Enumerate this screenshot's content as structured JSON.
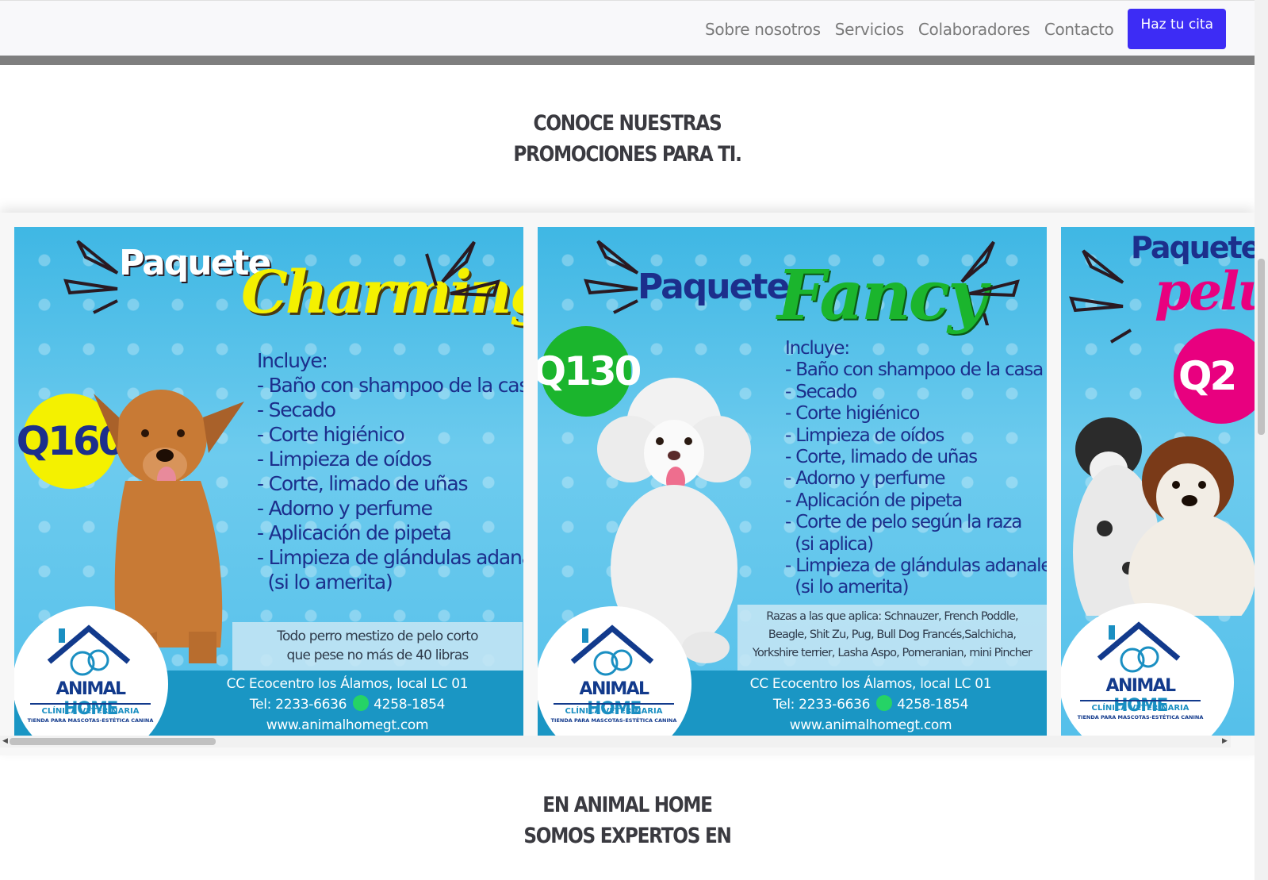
{
  "nav": {
    "links": [
      "Sobre nosotros",
      "Servicios",
      "Colaboradores",
      "Contacto"
    ],
    "cta": "Haz tu cita"
  },
  "promo_heading": {
    "line1": "CONOCE NUESTRAS",
    "line2": "PROMOCIONES PARA TI."
  },
  "cards": [
    {
      "paquete": "Paquete",
      "name": "Charming",
      "price": "Q160",
      "includes_label": "Incluye:",
      "items": [
        "- Baño con shampoo de la casa",
        "- Secado",
        "- Corte higiénico",
        "- Limpieza de oídos",
        "- Corte, limado de uñas",
        "- Adorno y perfume",
        "- Aplicación de pipeta",
        "- Limpieza de glándulas adanales",
        "  (si lo amerita)"
      ],
      "note": [
        "Todo perro mestizo de pelo corto",
        "que pese no más de 40 libras"
      ],
      "address": "CC Ecocentro los Álamos, local LC 01",
      "tel": "Tel: 2233-6636",
      "whatsapp": "4258-1854",
      "web": "www.animalhomegt.com",
      "logo": {
        "title_a": "ANIMAL",
        "title_b": "HOME",
        "sub1": "CLÍNICA VETERINARIA",
        "sub2": "TIENDA PARA MASCOTAS-ESTÉTICA CANINA"
      }
    },
    {
      "paquete": "Paquete",
      "name": "Fancy",
      "price": "Q130",
      "includes_label": "Incluye:",
      "items": [
        "- Baño con shampoo de la casa",
        "- Secado",
        "- Corte higiénico",
        "- Limpieza de oídos",
        "- Corte, limado de uñas",
        "- Adorno y perfume",
        "- Aplicación de pipeta",
        "- Corte de pelo según la raza",
        "  (si aplica)",
        "- Limpieza de glándulas adanales",
        "  (si lo amerita)"
      ],
      "note": [
        "Razas a las que aplica: Schnauzer, French Poddle,",
        "Beagle, Shit Zu, Pug, Bull Dog Francés,Salchicha,",
        "Yorkshire terrier, Lasha Aspo, Pomeranian, mini Pincher"
      ],
      "address": "CC Ecocentro los Álamos, local LC 01",
      "tel": "Tel: 2233-6636",
      "whatsapp": "4258-1854",
      "web": "www.animalhomegt.com",
      "logo": {
        "title_a": "ANIMAL",
        "title_b": "HOME",
        "sub1": "CLÍNICA VETERINARIA",
        "sub2": "TIENDA PARA MASCOTAS-ESTÉTICA CANINA"
      }
    },
    {
      "paquete": "Paquete",
      "name": "pelu",
      "price": "Q2",
      "logo": {
        "title_a": "ANIMAL",
        "title_b": "HOME",
        "sub1": "CLÍNICA VETERINARIA",
        "sub2": "TIENDA PARA MASCOTAS-ESTÉTICA CANINA"
      }
    }
  ],
  "expert_heading": {
    "line1": "EN ANIMAL HOME",
    "line2": "SOMOS EXPERTOS EN"
  },
  "colors": {
    "cta": "#3d2cf5",
    "charming": "#f4f100",
    "fancy": "#1bb52d",
    "third": "#e8007f",
    "text_blue": "#1c2f8c"
  }
}
